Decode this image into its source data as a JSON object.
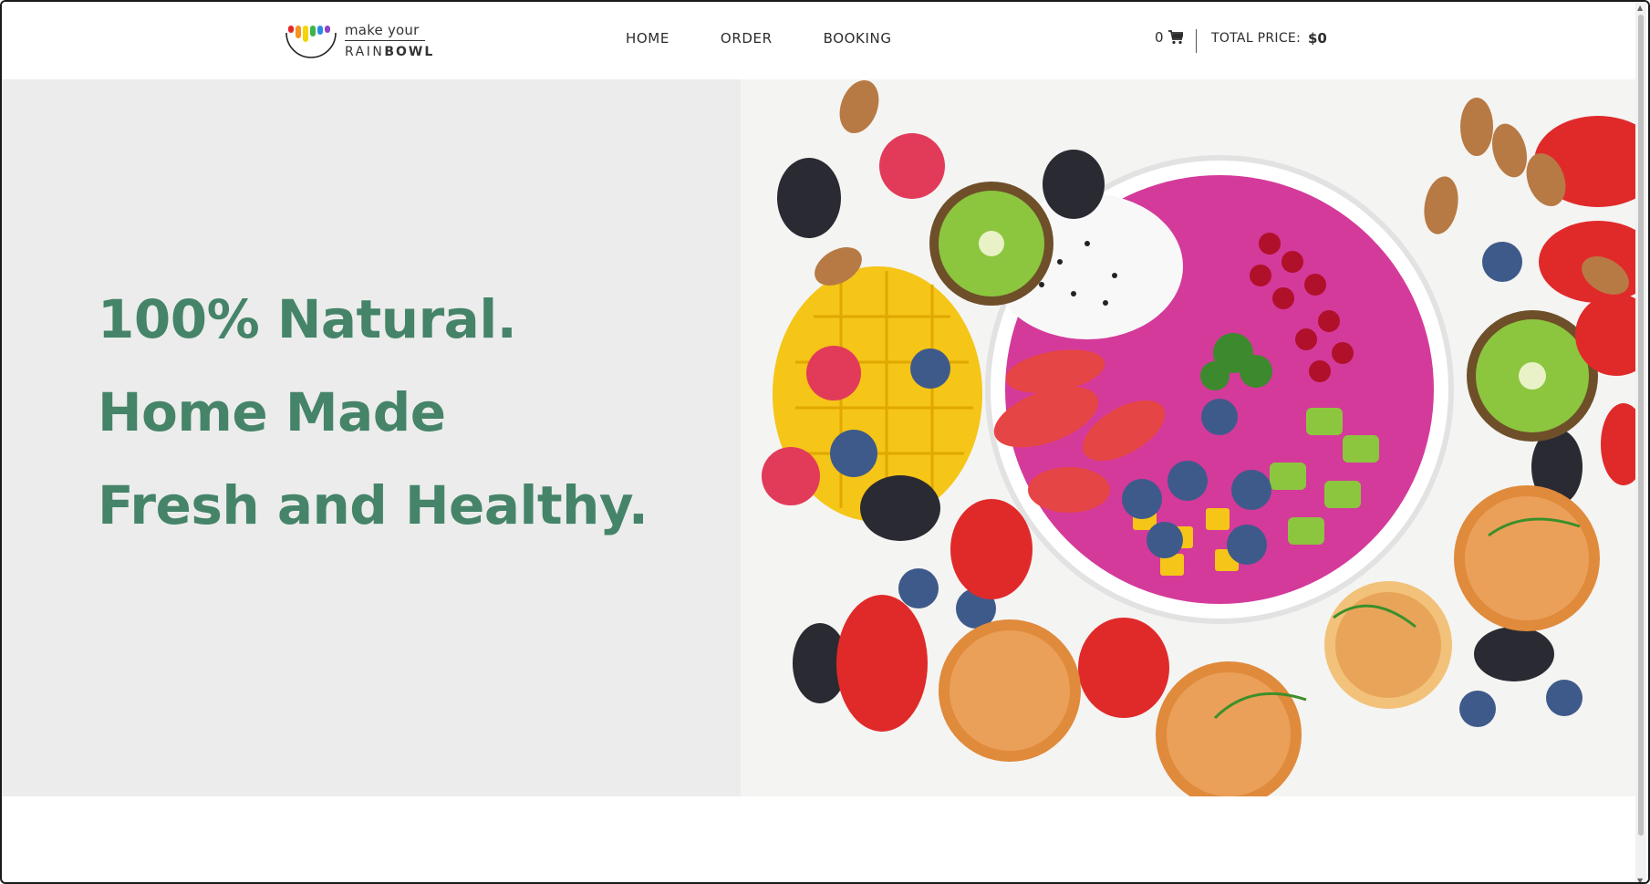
{
  "brand": {
    "logo_top": "make your",
    "logo_bottom_light": "RAIN",
    "logo_bottom_bold": "BOWL",
    "drip_colors": [
      "#e8262a",
      "#f7931e",
      "#f5d50a",
      "#3cb44b",
      "#2b8be6",
      "#8e44c9"
    ]
  },
  "nav": {
    "home": "HOME",
    "order": "ORDER",
    "booking": "BOOKING"
  },
  "cart": {
    "count": "0",
    "icon": "shopping-cart-icon",
    "total_label": "TOTAL PRICE:",
    "total_value": "$0"
  },
  "hero": {
    "line1": "100% Natural.",
    "line2": "Home Made",
    "line3": "Fresh and Healthy.",
    "text_color": "#458469",
    "background": "#ebeceb"
  }
}
